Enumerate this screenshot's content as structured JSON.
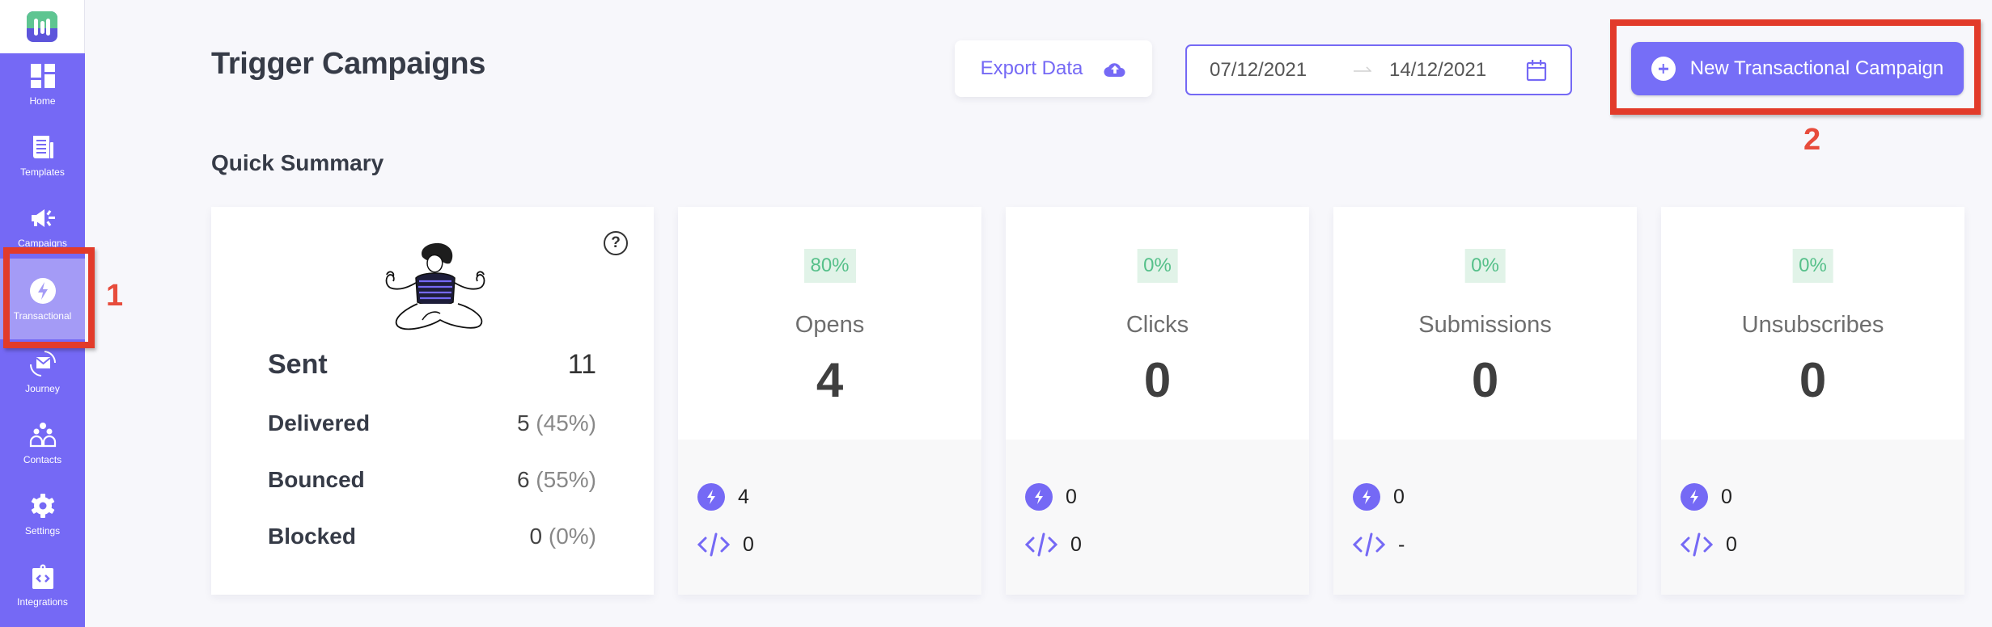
{
  "sidebar": {
    "logo": "app-logo",
    "items": [
      {
        "label": "Home",
        "icon": "dashboard-icon",
        "active": false
      },
      {
        "label": "Templates",
        "icon": "document-icon",
        "active": false
      },
      {
        "label": "Campaigns",
        "icon": "megaphone-icon",
        "active": false
      },
      {
        "label": "Transactional",
        "icon": "bolt-icon",
        "active": true
      },
      {
        "label": "Journey",
        "icon": "mail-cycle-icon",
        "active": false
      },
      {
        "label": "Contacts",
        "icon": "users-icon",
        "active": false
      },
      {
        "label": "Settings",
        "icon": "gear-icon",
        "active": false
      },
      {
        "label": "Integrations",
        "icon": "code-clipboard-icon",
        "active": false
      }
    ]
  },
  "header": {
    "title": "Trigger Campaigns",
    "export_label": "Export Data",
    "export_icon": "cloud-upload-icon",
    "date_start": "07/12/2021",
    "date_end": "14/12/2021",
    "date_icon": "calendar-icon",
    "new_campaign_label": "New Transactional Campaign",
    "new_campaign_icon": "plus-circle-icon"
  },
  "annotations": {
    "first": "1",
    "second": "2",
    "color": "#e23b2a"
  },
  "summary": {
    "section_title": "Quick Summary",
    "help_icon": "?",
    "sent": {
      "label": "Sent",
      "value": "11"
    },
    "rows": [
      {
        "label": "Delivered",
        "value": "5",
        "pct": "(45%)"
      },
      {
        "label": "Bounced",
        "value": "6",
        "pct": "(55%)"
      },
      {
        "label": "Blocked",
        "value": "0",
        "pct": "(0%)"
      }
    ]
  },
  "metrics": [
    {
      "label": "Opens",
      "badge": "80%",
      "value": "4",
      "trigger_count": "4",
      "api_count": "0"
    },
    {
      "label": "Clicks",
      "badge": "0%",
      "value": "0",
      "trigger_count": "0",
      "api_count": "0"
    },
    {
      "label": "Submissions",
      "badge": "0%",
      "value": "0",
      "trigger_count": "0",
      "api_count": "-"
    },
    {
      "label": "Unsubscribes",
      "badge": "0%",
      "value": "0",
      "trigger_count": "0",
      "api_count": "0"
    }
  ],
  "colors": {
    "brand": "#7569f5",
    "sidebar_active": "#a49bf6",
    "badge_bg": "#e1f3e8",
    "badge_text": "#56c08a",
    "logo_green": "#5ec591"
  }
}
